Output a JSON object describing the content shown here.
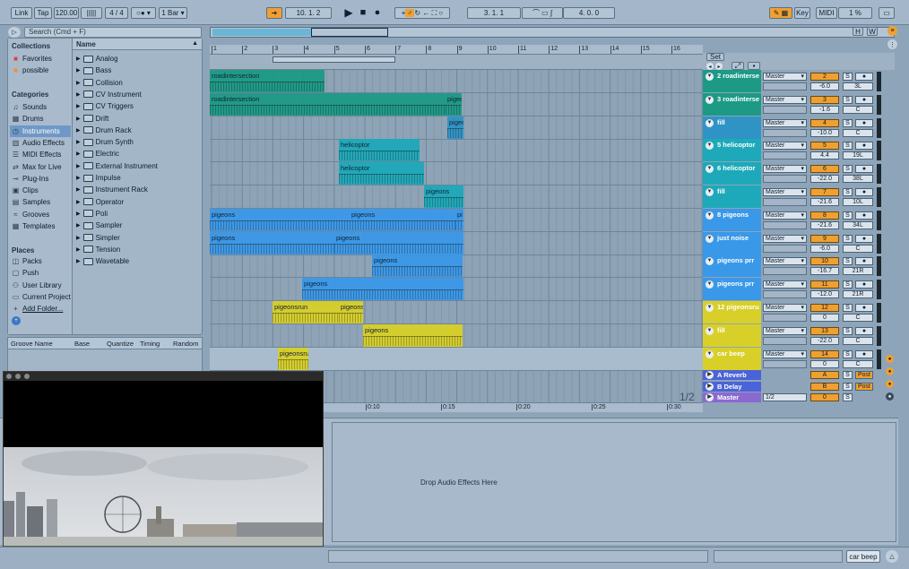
{
  "transport": {
    "link": "Link",
    "tap": "Tap",
    "tempo": "120.00",
    "signature": "4 / 4",
    "quantize": "1 Bar",
    "position": "10.  1.  2",
    "loop_start": "3.  1.  1",
    "loop_length": "4.  0.  0",
    "key": "Key",
    "midi": "MIDI",
    "cpu": "1 %"
  },
  "browser": {
    "search_placeholder": "Search (Cmd + F)",
    "collections_head": "Collections",
    "collections": [
      {
        "label": "Favorites",
        "color": "#e04040"
      },
      {
        "label": "possible",
        "color": "#f09030"
      }
    ],
    "categories_head": "Categories",
    "categories": [
      {
        "label": "Sounds",
        "icon": "♫"
      },
      {
        "label": "Drums",
        "icon": "▦"
      },
      {
        "label": "Instruments",
        "icon": "◷"
      },
      {
        "label": "Audio Effects",
        "icon": "▥"
      },
      {
        "label": "MIDI Effects",
        "icon": "☰"
      },
      {
        "label": "Max for Live",
        "icon": "⇄"
      },
      {
        "label": "Plug-Ins",
        "icon": "⊸"
      },
      {
        "label": "Clips",
        "icon": "▣"
      },
      {
        "label": "Samples",
        "icon": "▤"
      },
      {
        "label": "Grooves",
        "icon": "≈"
      },
      {
        "label": "Templates",
        "icon": "▦"
      }
    ],
    "places_head": "Places",
    "places": [
      {
        "label": "Packs",
        "icon": "◫"
      },
      {
        "label": "Push",
        "icon": "▢"
      },
      {
        "label": "User Library",
        "icon": "⚇"
      },
      {
        "label": "Current Project",
        "icon": "▭"
      },
      {
        "label": "Add Folder...",
        "icon": "+"
      }
    ],
    "name_head": "Name",
    "items": [
      "Analog",
      "Bass",
      "Collision",
      "CV Instrument",
      "CV Triggers",
      "Drift",
      "Drum Rack",
      "Drum Synth",
      "Electric",
      "External Instrument",
      "Impulse",
      "Instrument Rack",
      "Operator",
      "Poli",
      "Sampler",
      "Simpler",
      "Tension",
      "Wavetable"
    ]
  },
  "groove": {
    "name": "Groove Name",
    "base": "Base",
    "quantize": "Quantize",
    "timing": "Timing",
    "random": "Random"
  },
  "ruler": {
    "bars": [
      "1",
      "2",
      "3",
      "4",
      "5",
      "6",
      "7",
      "8",
      "9",
      "10",
      "11",
      "12",
      "13",
      "14",
      "15",
      "16"
    ],
    "times": [
      "0:10",
      "0:15",
      "0:20",
      "0:25",
      "0:30"
    ]
  },
  "arr_page": "1/2",
  "tracks": [
    {
      "name": "2 roadinterse",
      "num": "2",
      "vol": "-6.0",
      "pan": "3L",
      "color": "#1c9a86"
    },
    {
      "name": "3 roadinterse",
      "num": "3",
      "vol": "-1.6",
      "pan": "C",
      "color": "#1c9a86"
    },
    {
      "name": "fill",
      "num": "4",
      "vol": "-10.0",
      "pan": "C",
      "color": "#2f93c6"
    },
    {
      "name": "5 helicoptor",
      "num": "5",
      "vol": "4.4",
      "pan": "19L",
      "color": "#1da9b9"
    },
    {
      "name": "6 helicoptor",
      "num": "6",
      "vol": "-22.0",
      "pan": "38L",
      "color": "#1da9b9"
    },
    {
      "name": "fill",
      "num": "7",
      "vol": "-21.6",
      "pan": "10L",
      "color": "#1da9b9"
    },
    {
      "name": "8 pigeons",
      "num": "8",
      "vol": "-21.6",
      "pan": "34L",
      "color": "#3a98e8"
    },
    {
      "name": "just noise",
      "num": "9",
      "vol": "-6.0",
      "pan": "C",
      "color": "#3a98e8"
    },
    {
      "name": "pigeons prr",
      "num": "10",
      "vol": "-16.7",
      "pan": "21R",
      "color": "#3a98e8"
    },
    {
      "name": "pigeons prr",
      "num": "11",
      "vol": "-12.0",
      "pan": "21R",
      "color": "#3a98e8"
    },
    {
      "name": "12 pigeonsru",
      "num": "12",
      "vol": "0",
      "pan": "C",
      "color": "#d8d028"
    },
    {
      "name": "fill",
      "num": "13",
      "vol": "-22.0",
      "pan": "C",
      "color": "#d8d028"
    },
    {
      "name": "car beep",
      "num": "14",
      "vol": "0",
      "pan": "C",
      "color": "#d8d028"
    }
  ],
  "returns": [
    {
      "name": "A Reverb",
      "num": "A",
      "post": "Post",
      "color": "#4b63d8"
    },
    {
      "name": "B Delay",
      "num": "B",
      "post": "Post",
      "color": "#4b63d8"
    },
    {
      "name": "Master",
      "num": "0",
      "post": "1/2",
      "color": "#8a6ad0"
    }
  ],
  "route": "Master",
  "set_label": "Set",
  "detail_drop": "Drop Audio Effects Here",
  "status_track": "car beep",
  "hw": {
    "h": "H",
    "w": "W"
  }
}
